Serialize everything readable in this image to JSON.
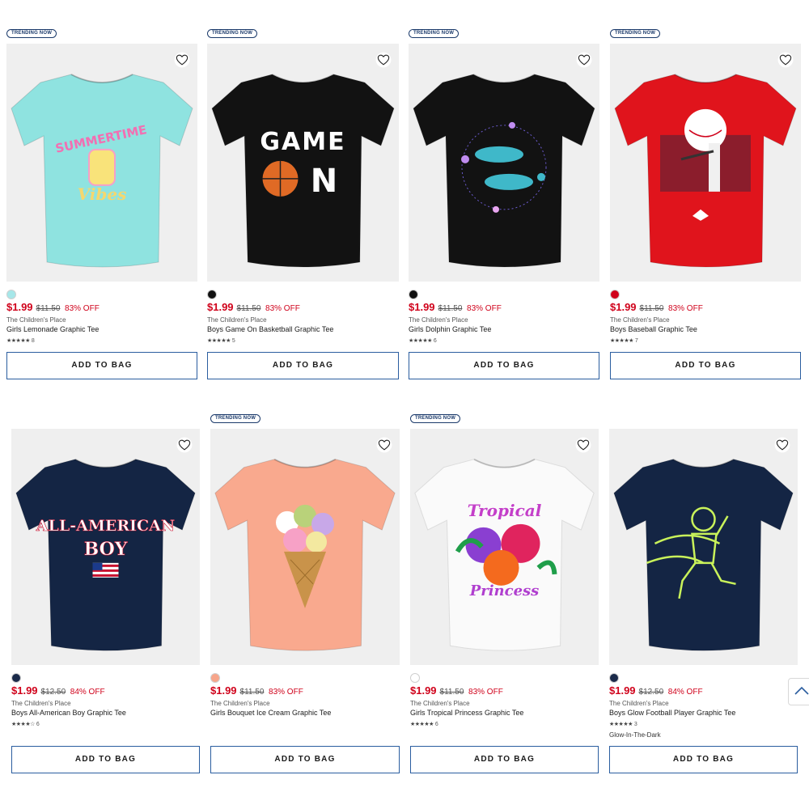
{
  "badge_text": "TRENDING NOW",
  "add_to_bag_label": "ADD TO BAG",
  "products": [
    {
      "name": "Girls Lemonade Graphic Tee",
      "brand": "The Children's Place",
      "sale_price": "$1.99",
      "original_price": "$11.50",
      "discount": "83% OFF",
      "stars": "★★★★★",
      "review_count": "8",
      "swatch_color": "#a6e7e9",
      "trending": true,
      "tee_color": "#8fe3e0",
      "graphic_text": "SUMMERTIME Vibes"
    },
    {
      "name": "Boys Game On Basketball Graphic Tee",
      "brand": "The Children's Place",
      "sale_price": "$1.99",
      "original_price": "$11.50",
      "discount": "83% OFF",
      "stars": "★★★★★",
      "review_count": "5",
      "swatch_color": "#111111",
      "trending": true,
      "tee_color": "#121212",
      "graphic_text": "GAME ON"
    },
    {
      "name": "Girls Dolphin Graphic Tee",
      "brand": "The Children's Place",
      "sale_price": "$1.99",
      "original_price": "$11.50",
      "discount": "83% OFF",
      "stars": "★★★★★",
      "review_count": "6",
      "swatch_color": "#111111",
      "trending": true,
      "tee_color": "#121212",
      "graphic_text": ""
    },
    {
      "name": "Boys Baseball Graphic Tee",
      "brand": "The Children's Place",
      "sale_price": "$1.99",
      "original_price": "$11.50",
      "discount": "83% OFF",
      "stars": "★★★★★",
      "review_count": "7",
      "swatch_color": "#d0021b",
      "trending": true,
      "tee_color": "#e0141c",
      "graphic_text": ""
    },
    {
      "name": "Boys All-American Boy Graphic Tee",
      "brand": "The Children's Place",
      "sale_price": "$1.99",
      "original_price": "$12.50",
      "discount": "84% OFF",
      "stars": "★★★★☆",
      "review_count": "6",
      "swatch_color": "#1b2a4a",
      "trending": false,
      "tee_color": "#142544",
      "graphic_text": "ALL-AMERICAN BOY"
    },
    {
      "name": "Girls Bouquet Ice Cream Graphic Tee",
      "brand": "The Children's Place",
      "sale_price": "$1.99",
      "original_price": "$11.50",
      "discount": "83% OFF",
      "stars": "",
      "review_count": "",
      "swatch_color": "#f7a58a",
      "trending": true,
      "tee_color": "#f9a98e",
      "graphic_text": ""
    },
    {
      "name": "Girls Tropical Princess Graphic Tee",
      "brand": "The Children's Place",
      "sale_price": "$1.99",
      "original_price": "$11.50",
      "discount": "83% OFF",
      "stars": "★★★★★",
      "review_count": "6",
      "swatch_color": "#ffffff",
      "trending": true,
      "tee_color": "#fafafa",
      "graphic_text": "Tropical Princess"
    },
    {
      "name": "Boys Glow Football Player Graphic Tee",
      "brand": "The Children's Place",
      "sale_price": "$1.99",
      "original_price": "$12.50",
      "discount": "84% OFF",
      "stars": "★★★★★",
      "review_count": "3",
      "swatch_color": "#1b2a4a",
      "trending": false,
      "tee_color": "#142544",
      "graphic_text": "",
      "tag": "Glow-In-The-Dark"
    }
  ]
}
